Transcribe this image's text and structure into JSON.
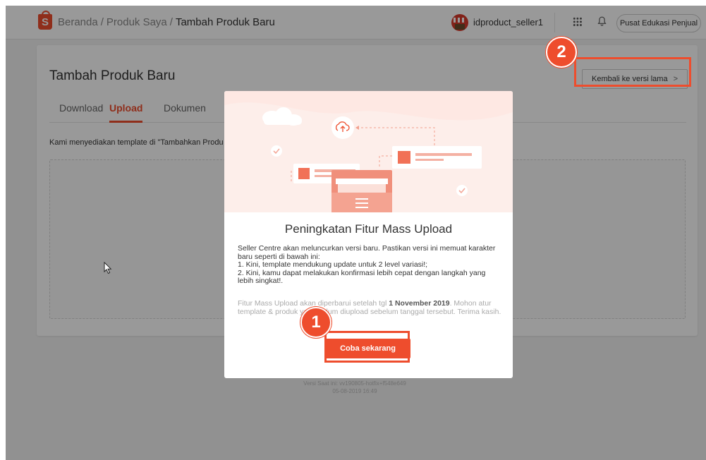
{
  "header": {
    "breadcrumb": [
      "Beranda",
      "Produk Saya",
      "Tambah Produk Baru"
    ],
    "breadcrumb_sep": "/",
    "username": "idproduct_seller1",
    "edu_button": "Pusat Edukasi Penjual",
    "icons": {
      "logo": "shopee-bag-icon",
      "shop": "shop-avatar-icon",
      "apps": "grid-icon",
      "notif": "bell-icon"
    }
  },
  "page": {
    "title": "Tambah Produk Baru",
    "tabs": [
      {
        "label": "Download",
        "active": false
      },
      {
        "label": "Upload",
        "active": true
      },
      {
        "label": "Dokumen",
        "active": false
      }
    ],
    "description": "Kami menyediakan template di \"Tambahkan Produ",
    "legacy_button": "Kembali ke versi lama",
    "legacy_chevron": ">",
    "version_line1": "Versi Saat ini: vv190805-hotfix+f548e649",
    "version_line2": "05-08-2019 16:49"
  },
  "modal": {
    "title": "Peningkatan Fitur Mass Upload",
    "body": [
      "Seller Centre akan meluncurkan versi baru. Pastikan versi ini memuat karakter baru seperti di bawah ini:",
      "1. Kini, template mendukung update untuk 2 level variasi!;",
      "2. Kini, kamu dapat melakukan konfirmasi lebih cepat dengan langkah yang lebih singkat!."
    ],
    "note_pre": "Fitur Mass Upload akan diperbarui setelah tgl ",
    "note_date": "1 November 2019",
    "note_post": ". Mohon atur template & produk yang belum diupload sebelum tanggal tersebut. Terima kasih.",
    "button": "Coba sekarang"
  },
  "annotations": {
    "badge1": "1",
    "badge2": "2"
  },
  "colors": {
    "accent": "#ee4d2d",
    "overlay": "rgba(0,0,0,0.4)"
  }
}
